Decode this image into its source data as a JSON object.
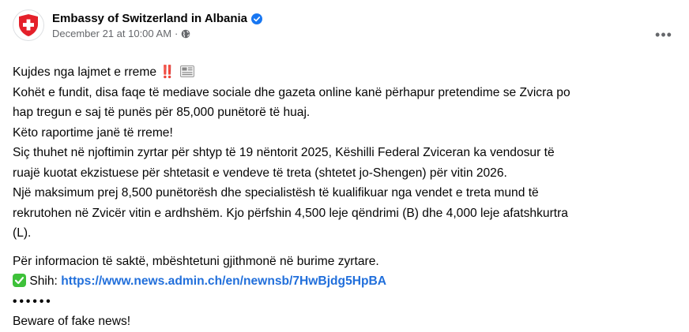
{
  "post": {
    "page_name": "Embassy of Switzerland in Albania",
    "timestamp": "December 21 at 10:00 AM",
    "separator": "·",
    "privacy_icon": "globe-icon",
    "more_icon": "more-horizontal-icon",
    "more_label": "•••",
    "colors": {
      "flag_red": "#e4202a",
      "verified_blue": "#1877f2",
      "link": "#216fdb",
      "secondary_text": "#65676b"
    }
  },
  "content": {
    "line1_text": "Kujdes nga lajmet e rreme",
    "line1_bang": "‼️",
    "line1_news_icon": "newspaper-icon",
    "line2": "Kohët e fundit, disa faqe të mediave sociale dhe gazeta online kanë përhapur pretendime se Zvicra po",
    "line3": "hap tregun e saj të punës për 85,000 punëtorë të huaj.",
    "line4": "Këto raportime janë të rreme!",
    "line5": "Siç thuhet në njoftimin zyrtar për shtyp të 19 nëntorit 2025, Këshilli Federal Zviceran ka vendosur të",
    "line6": "ruajë kuotat ekzistuese për shtetasit e vendeve të treta (shtetet jo-Shengen) për vitin 2026.",
    "line7": "Një maksimum prej 8,500 punëtorësh dhe specialistësh të kualifikuar nga vendet e treta mund të",
    "line8": "rekrutohen në Zvicër vitin e ardhshëm. Kjo përfshin 4,500 leje qëndrimi (B) dhe 4,000 leje afatshkurtra",
    "line9": "(L).",
    "line10": "Për informacion të saktë, mbështetuni gjithmonë në burime zyrtare.",
    "line11_label": "Shih:",
    "line11_icon": "check-mark-icon",
    "line11_link": "https://www.news.admin.ch/en/newnsb/7HwBjdg5HpBA",
    "bullets": "••••••",
    "line12": "Beware of fake news!"
  }
}
